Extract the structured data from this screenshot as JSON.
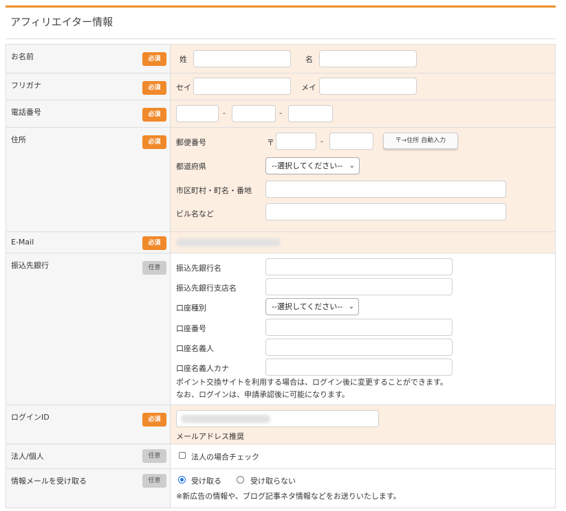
{
  "section_title": "アフィリエイター情報",
  "badges": {
    "required": "必須",
    "optional": "任意"
  },
  "rows": {
    "name": {
      "label": "お名前",
      "sei": "姓",
      "mei": "名"
    },
    "kana": {
      "label": "フリガナ",
      "sei": "セイ",
      "mei": "メイ"
    },
    "phone": {
      "label": "電話番号",
      "sep": "-"
    },
    "address": {
      "label": "住所",
      "postal_label": "郵便番号",
      "postal_mark": "〒",
      "sep": "-",
      "auto_fill_button": "〒→住所 自動入力",
      "prefecture_label": "都道府県",
      "prefecture_select": "--選択してください--",
      "city_label": "市区町村・町名・番地",
      "building_label": "ビル名など"
    },
    "email": {
      "label": "E-Mail"
    },
    "bank": {
      "label": "振込先銀行",
      "bank_name": "振込先銀行名",
      "branch_name": "振込先銀行支店名",
      "account_type": "口座種別",
      "account_type_select": "--選択してください--",
      "account_number": "口座番号",
      "account_holder": "口座名義人",
      "account_holder_kana": "口座名義人カナ",
      "note_line1": "ポイント交換サイトを利用する場合は、ログイン後に変更することができます。",
      "note_line2": "なお、ログインは、申請承認後に可能になります。"
    },
    "login": {
      "label": "ログインID",
      "hint": "メールアドレス推奨"
    },
    "corporate": {
      "label": "法人/個人",
      "checkbox": "法人の場合チェック"
    },
    "newsletter": {
      "label": "情報メールを受け取る",
      "yes": "受け取る",
      "no": "受け取らない",
      "note": "※新広告の情報や、ブログ記事ネタ情報などをお送りいたします。"
    }
  }
}
